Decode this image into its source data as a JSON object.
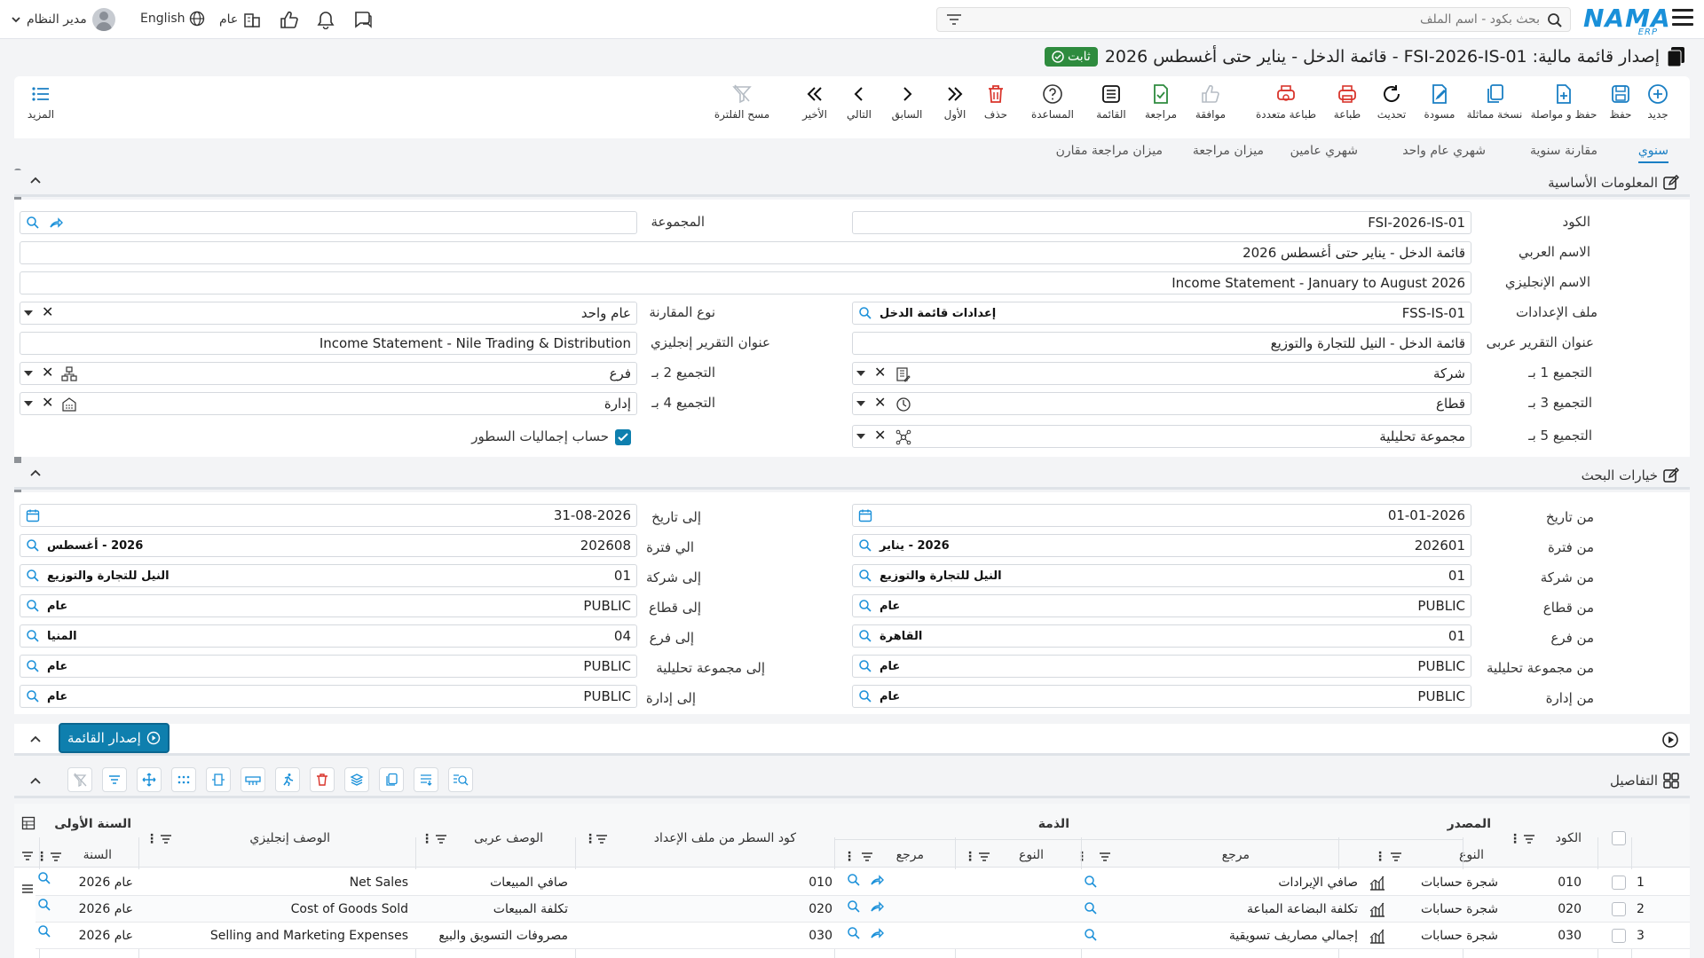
{
  "topbar": {
    "search_placeholder": "بحث بكود - اسم الملف",
    "logo": "NAMA",
    "logo_sub": "ERP",
    "user": "مدير النظام",
    "language": "English",
    "year": "عام"
  },
  "title": {
    "text": "إصدار قائمة مالية: FSI-2026-IS-01 - قائمة الدخل - يناير حتى أغسطس 2026",
    "status": "ثابت"
  },
  "toolbar": {
    "new": "جديد",
    "save": "حفظ",
    "save_continue": "حفظ و مواصلة",
    "duplicate": "نسخة مماثلة",
    "draft": "مسودة",
    "refresh": "تحديث",
    "print": "طباعة",
    "multi_print": "طباعة متعددة",
    "approve": "موافقة",
    "review": "مراجعة",
    "list": "القائمة",
    "help": "المساعدة",
    "delete": "حذف",
    "first": "الأول",
    "previous": "السابق",
    "next": "التالي",
    "last": "الأخير",
    "clear_filter": "مسح الفلترة",
    "more": "المزيد"
  },
  "tabs": [
    "سنوي",
    "مقارنة سنوية",
    "شهري عام واحد",
    "شهري عامين",
    "ميزان مراجعة",
    "ميزان مراجعة مقارن"
  ],
  "basic_info": {
    "title": "المعلومات الأساسية",
    "code_label": "الكود",
    "code": "FSI-2026-IS-01",
    "group_label": "المجموعة",
    "group": "",
    "arabic_name_label": "الاسم العربي",
    "arabic_name": "قائمة الدخل - يناير حتى أغسطس 2026",
    "english_name_label": "الاسم الإنجليزي",
    "english_name": "Income Statement - January to August 2026",
    "settings_file_label": "ملف الإعدادات",
    "settings_file_code": "FSS-IS-01",
    "settings_file_name": "إعدادات قائمة الدخل",
    "comparison_type_label": "نوع المقارنة",
    "comparison_type": "عام واحد",
    "ar_report_title_label": "عنوان التقرير عربى",
    "ar_report_title": "قائمة الدخل - النيل للتجارة والتوزيع",
    "en_report_title_label": "عنوان التقرير إنجليزي",
    "en_report_title": "Income Statement - Nile Trading & Distribution",
    "group1_label": "التجميع 1 بـ",
    "group1": "شركة",
    "group2_label": "التجميع 2 بـ",
    "group2": "فرع",
    "group3_label": "التجميع 3 بـ",
    "group3": "قطاع",
    "group4_label": "التجميع 4 بـ",
    "group4": "إدارة",
    "group5_label": "التجميع 5 بـ",
    "group5": "مجموعة تحليلية",
    "row_totals_label": "حساب إجماليات السطور",
    "row_totals": true
  },
  "search_options": {
    "title": "خيارات البحث",
    "from_date_label": "من تاريخ",
    "from_date": "01-01-2026",
    "to_date_label": "إلى تاريخ",
    "to_date": "31-08-2026",
    "from_period_label": "من فترة",
    "from_period": "202601",
    "from_period_name": "2026 - يناير",
    "to_period_label": "الي فترة",
    "to_period": "202608",
    "to_period_name": "2026 - أغسطس",
    "from_company_label": "من شركة",
    "from_company": "01",
    "from_company_name": "النيل للتجارة والتوزيع",
    "to_company_label": "إلى شركة",
    "to_company": "01",
    "to_company_name": "النيل للتجارة والتوزيع",
    "from_sector_label": "من قطاع",
    "from_sector": "PUBLIC",
    "from_sector_name": "عام",
    "to_sector_label": "إلى قطاع",
    "to_sector": "PUBLIC",
    "to_sector_name": "عام",
    "from_branch_label": "من فرع",
    "from_branch": "01",
    "from_branch_name": "القاهرة",
    "to_branch_label": "إلى فرع",
    "to_branch": "04",
    "to_branch_name": "المنيا",
    "from_ag_label": "من مجموعة تحليلية",
    "from_ag": "PUBLIC",
    "from_ag_name": "عام",
    "to_ag_label": "إلى مجموعة تحليلية",
    "to_ag": "PUBLIC",
    "to_ag_name": "عام",
    "from_dept_label": "من إدارة",
    "from_dept": "PUBLIC",
    "from_dept_name": "عام",
    "to_dept_label": "إلى إدارة",
    "to_dept": "PUBLIC",
    "to_dept_name": "عام"
  },
  "issue_button": "إصدار القائمة",
  "details": {
    "title": "التفاصيل",
    "col_code": "الكود",
    "col_source": "المصدر",
    "col_type": "النوع",
    "col_ref": "مرجع",
    "col_liability": "الذمة",
    "col_liab_type": "النوع",
    "col_liab_ref": "مرجع",
    "col_line_code": "كود السطر من ملف الإعداد",
    "col_ar_desc": "الوصف عربى",
    "col_en_desc": "الوصف إنجليزي",
    "col_first_year": "السنة الأولى",
    "col_year": "السنة",
    "rows": [
      {
        "num": "1",
        "code": "010",
        "type": "شجرة حسابات",
        "ref": "صافي الإيرادات",
        "line_code": "010",
        "ar": "صافي المبيعات",
        "en": "Net Sales",
        "year": "عام 2026"
      },
      {
        "num": "2",
        "code": "020",
        "type": "شجرة حسابات",
        "ref": "تكلفة البضاعة المباعة",
        "line_code": "020",
        "ar": "تكلفة المبيعات",
        "en": "Cost of Goods Sold",
        "year": "عام 2026"
      },
      {
        "num": "3",
        "code": "030",
        "type": "شجرة حسابات",
        "ref": "إجمالي مصاريف تسويقية",
        "line_code": "030",
        "ar": "مصروفات التسويق والبيع",
        "en": "Selling and Marketing Expenses",
        "year": "عام 2026"
      }
    ]
  },
  "colors": {
    "accent": "#1a7fc4",
    "primary_button": "#0e7fae",
    "success": "#2e8b3e",
    "danger": "#d9342b"
  }
}
